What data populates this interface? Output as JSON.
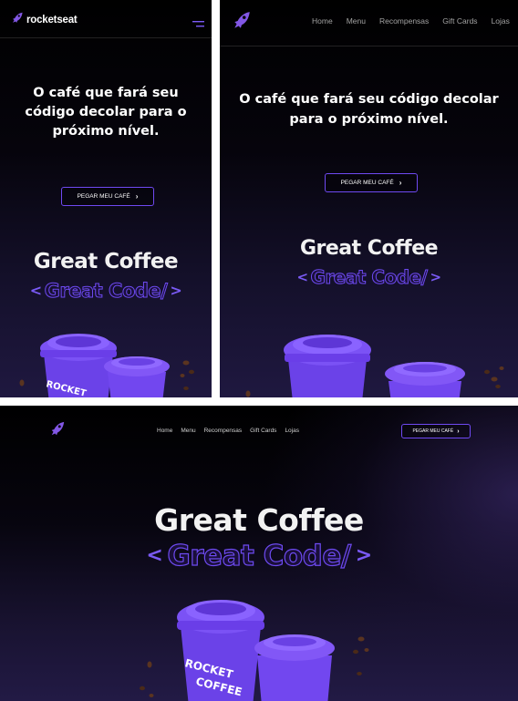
{
  "brand": {
    "name": "rocketseat",
    "accent": "#6f49f2",
    "accent_light": "#8257e5",
    "background": "#000000"
  },
  "nav": {
    "items": [
      "Home",
      "Menu",
      "Recompensas",
      "Gift Cards",
      "Lojas"
    ]
  },
  "hero": {
    "headline": "O café que fará seu código decolar para o próximo nível.",
    "title": "Great Coffee",
    "subtitle_open": "<",
    "subtitle": "Great Code/",
    "subtitle_close": ">",
    "cta_label": "PEGAR MEU CAFÉ",
    "cta_icon": "chevron-right-icon"
  },
  "cups": {
    "label_line1": "ROCKET",
    "label_line2": "COFFEE",
    "cup_color": "#7b52f5",
    "lid_color": "#6a3ee8"
  },
  "icons": {
    "logo": "rocket-icon",
    "menu": "hamburger-menu-icon"
  }
}
